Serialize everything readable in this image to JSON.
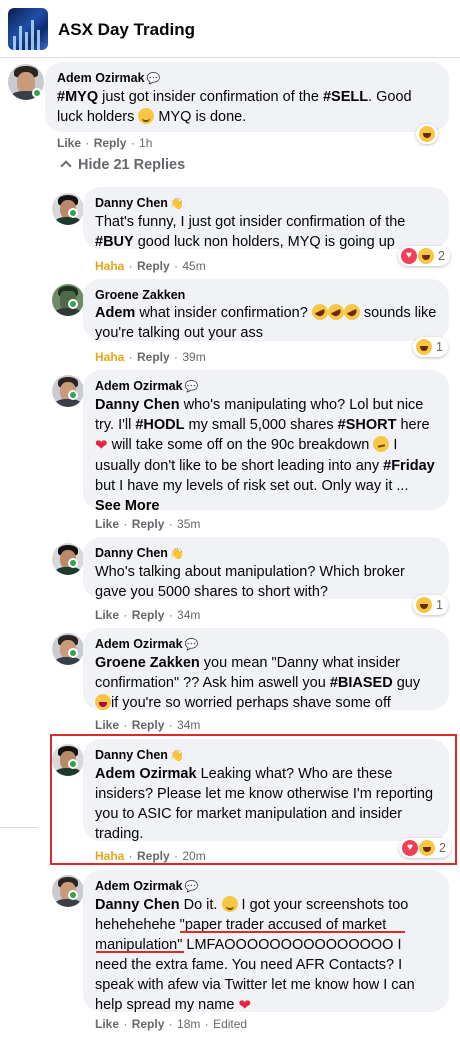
{
  "group": {
    "title": "ASX Day Trading"
  },
  "hide_replies_label": "Hide 21 Replies",
  "actions": {
    "like": "Like",
    "reply": "Reply",
    "haha": "Haha",
    "see_more": "See More",
    "edited": "Edited"
  },
  "comments": [
    {
      "author": "Adem Ozirmak",
      "t": [
        "#MYQ",
        " just got insider confirmation of the ",
        "#SELL",
        ". Good luck holders ",
        " MYQ is done."
      ],
      "reaction_label": "Like",
      "time": "1h"
    },
    {
      "author": "Danny Chen",
      "t": [
        "That's funny, I just got insider confirmation of the ",
        "#BUY",
        " good luck non holders, MYQ is going up"
      ],
      "reaction_label": "Haha",
      "time": "45m",
      "reaction_count": "2"
    },
    {
      "author": "Groene Zakken",
      "t": [
        "Adem",
        " what insider confirmation? ",
        " sounds like you're talking out your ass"
      ],
      "reaction_label": "Haha",
      "time": "39m",
      "reaction_count": "1"
    },
    {
      "author": "Adem Ozirmak",
      "t": [
        "Danny Chen",
        " who's manipulating who? Lol but nice try. I'll ",
        "#HODL",
        " my small 5,000 shares ",
        "#SHORT",
        " here ",
        " will take some off on the 90c breakdown ",
        " I usually don't like to be short leading into any ",
        "#Friday",
        " but I have my levels of risk set out. Only way it ... "
      ],
      "reaction_label": "Like",
      "time": "35m"
    },
    {
      "author": "Danny Chen",
      "t": [
        "Who's talking about manipulation? Which broker gave you 5000 shares to short with?"
      ],
      "reaction_label": "Like",
      "time": "34m",
      "reaction_count": "1"
    },
    {
      "author": "Adem Ozirmak",
      "t": [
        "Groene Zakken",
        " you mean \"Danny what insider confirmation\" ?? Ask him aswell you ",
        "#BIASED",
        " guy ",
        "if you're so worried perhaps shave some off"
      ],
      "reaction_label": "Like",
      "time": "34m"
    },
    {
      "author": "Danny Chen",
      "t": [
        "Adem Ozirmak",
        " Leaking what? Who are these insiders? Please let me know otherwise I'm reporting you to ASIC for market manipulation and insider trading."
      ],
      "reaction_label": "Haha",
      "time": "20m",
      "reaction_count": "2"
    },
    {
      "author": "Adem Ozirmak",
      "t": [
        "Danny Chen",
        " Do it. ",
        " I got your screenshots too hehehehehe \"paper trader accused of market manipulation\" LMFAOOOOOOOOOOOOOOO I need the extra fame. You need AFR Contacts? I speak with afew via Twitter let me know how I can help spread my name "
      ],
      "reaction_label": "Like",
      "time": "18m"
    }
  ]
}
